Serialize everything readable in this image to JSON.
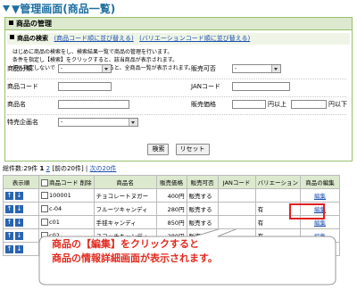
{
  "page_title": "▼管理画面(商品一覧)",
  "panel": {
    "header": "商品の管理",
    "search_title": "商品の検索",
    "link_code_sort": "(商品コード順に並び替える)",
    "link_variation_sort": "(バリエーションコード順に並び替える)",
    "description": [
      "はじめに商品の検索をし、検索結果一覧で商品の管理を行います。",
      "条件を指定し【検索】をクリックすると、該当商品が表示されます。",
      "何も指定しないで【検索】をクリックすると、全商品一覧が表示されます。"
    ],
    "fields": {
      "category_label": "商品分類",
      "category_value": "-",
      "sellable_label": "販売可否",
      "sellable_value": "-",
      "code_label": "商品コード",
      "jan_label": "JANコード",
      "name_label": "商品名",
      "price_label": "販売価格",
      "price_from_suffix": "円以上",
      "price_to_suffix": "円以下",
      "special_label": "特売企画名",
      "special_value": "-"
    },
    "search_button": "検索",
    "reset_button": "リセット"
  },
  "results": {
    "total_label": "総件数:29件",
    "page_1": "1",
    "page_2": "2",
    "prev": "[前の20件]",
    "next": "次の20件",
    "headers": {
      "order": "表示順",
      "code": "商品コード",
      "delete": "削除",
      "name": "商品名",
      "price": "販売価格",
      "sellable": "販売可否",
      "jan": "JANコード",
      "variation": "バリエーション",
      "edit": "商品の編集"
    },
    "rows": [
      {
        "code": "100001",
        "name": "チョコレートヌガー",
        "price": "400円",
        "sellable": "販売する",
        "jan": "",
        "variation": "",
        "edit": "編集"
      },
      {
        "code": "c-04",
        "name": "フルーツキャンディ",
        "price": "280円",
        "sellable": "販売する",
        "jan": "",
        "variation": "有",
        "edit": "編集"
      },
      {
        "code": "c01",
        "name": "手毬キャンディ",
        "price": "850円",
        "sellable": "販売する",
        "jan": "",
        "variation": "有",
        "edit": "編集"
      },
      {
        "code": "c02",
        "name": "スコッチキャンディ",
        "price": "280円",
        "sellable": "販売する",
        "jan": "",
        "variation": "有",
        "edit": "編集"
      },
      {
        "code": "",
        "name": "",
        "price": "",
        "sellable": "",
        "jan": "",
        "variation": "",
        "edit": "編集"
      }
    ]
  },
  "callout": {
    "line1": "商品の【編集】をクリックすると",
    "line2": "商品の情報詳細画面が表示されます。"
  },
  "colors": {
    "title": "#1d6fa0",
    "header_bg": "#dde9cf",
    "highlight": "#e02020",
    "callout_text": "#e12a1f"
  }
}
